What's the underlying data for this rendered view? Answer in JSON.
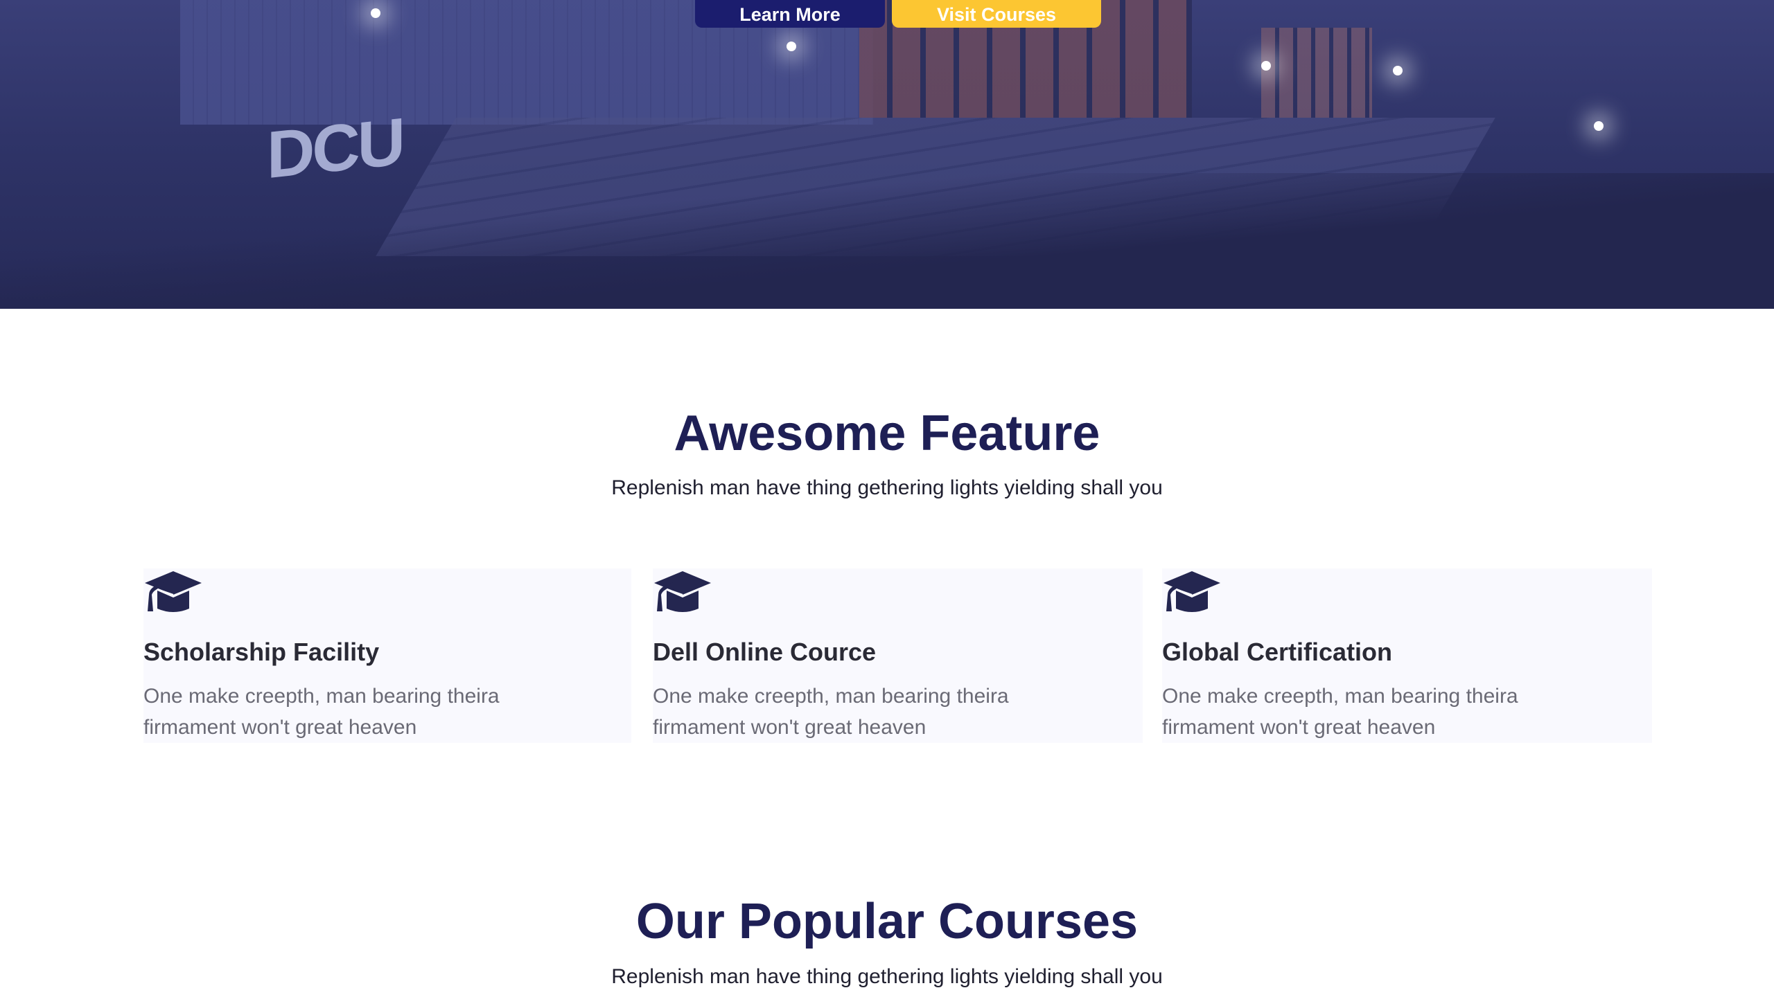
{
  "hero": {
    "logo_text": "DCU",
    "buttons": {
      "learn_more": "Learn More",
      "visit_courses": "Visit Courses"
    }
  },
  "features": {
    "title": "Awesome Feature",
    "subtitle": "Replenish man have thing gethering lights yielding shall you",
    "items": [
      {
        "icon": "graduation-cap-icon",
        "title": "Scholarship Facility",
        "description": "One make creepth, man bearing theira firmament won't great heaven"
      },
      {
        "icon": "graduation-cap-icon",
        "title": "Dell Online Cource",
        "description": "One make creepth, man bearing theira firmament won't great heaven"
      },
      {
        "icon": "graduation-cap-icon",
        "title": "Global Certification",
        "description": "One make creepth, man bearing theira firmament won't great heaven"
      }
    ]
  },
  "courses": {
    "title": "Our Popular Courses",
    "subtitle": "Replenish man have thing gethering lights yielding shall you"
  },
  "colors": {
    "heading": "#1e1f55",
    "primary_button": "#1b1d6e",
    "accent_button": "#fcc632",
    "card_bg": "#f9f9fe"
  }
}
